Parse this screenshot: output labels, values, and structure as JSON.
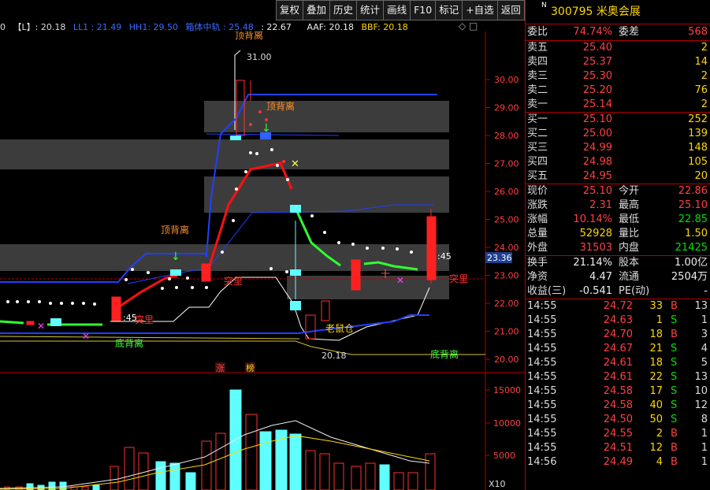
{
  "toolbar": [
    "复权",
    "叠加",
    "历史",
    "统计",
    "画线",
    "F10",
    "标记",
    "+自选",
    "返回"
  ],
  "indicator_bar": {
    "prefix": "0",
    "l_label": "【L】: 20.18",
    "ll1": "LL1 : 21.49",
    "hh1": "HH1: 29.50",
    "mid": "箱体中轨 : 25.48",
    "mid_val": ": 22.67",
    "aaf": "AAF: 20.18",
    "bbf": "BBF: 20.18"
  },
  "chart": {
    "price_axis": [
      "30.00",
      "29.00",
      "28.00",
      "27.00",
      "26.00",
      "25.00",
      "24.00",
      "23.00",
      "22.00",
      "21.00",
      "20.00"
    ],
    "current_price_tag": "23.36",
    "volume_axis": [
      "15000",
      "10000",
      "5000"
    ],
    "volume_unit": "X10",
    "annotations": {
      "high_value": "31.00",
      "low_value": "20.18",
      "top_divergence_1": "顶背离",
      "top_divergence_2": "顶背离",
      "top_divergence_cut": "顶背离",
      "bottom_divergence_1": "底背离",
      "bottom_divergence_2": "底背离",
      "breakout_1": "突里",
      "breakout_2": "突里",
      "breakout_3": "突里",
      "old_mouse": "老鼠仓",
      "time_45_a": ":45",
      "time_45_b": ":45",
      "tag_zhang": "涨",
      "tag_bang": "榜",
      "doji_marker": "十"
    }
  },
  "stock": {
    "code": "300795",
    "name": "米奥会展",
    "n_mark": "N"
  },
  "weibi": {
    "label1": "委比",
    "value": "74.74%",
    "label2": "委差",
    "diff": "568"
  },
  "asks": [
    {
      "label": "卖五",
      "price": "25.40",
      "vol": "2"
    },
    {
      "label": "卖四",
      "price": "25.37",
      "vol": "14"
    },
    {
      "label": "卖三",
      "price": "25.30",
      "vol": "2"
    },
    {
      "label": "卖二",
      "price": "25.20",
      "vol": "76"
    },
    {
      "label": "卖一",
      "price": "25.14",
      "vol": "2"
    }
  ],
  "bids": [
    {
      "label": "买一",
      "price": "25.10",
      "vol": "252"
    },
    {
      "label": "买二",
      "price": "25.00",
      "vol": "139"
    },
    {
      "label": "买三",
      "price": "24.99",
      "vol": "148"
    },
    {
      "label": "买四",
      "price": "24.98",
      "vol": "105"
    },
    {
      "label": "买五",
      "price": "24.95",
      "vol": "20"
    }
  ],
  "quote1": [
    {
      "l1": "现价",
      "v1": "25.10",
      "l2": "今开",
      "v2": "22.86"
    },
    {
      "l1": "涨跌",
      "v1": "2.31",
      "l2": "最高",
      "v2": "25.10"
    },
    {
      "l1": "涨幅",
      "v1": "10.14%",
      "l2": "最低",
      "v2": "22.85"
    },
    {
      "l1": "总量",
      "v1": "52928",
      "l2": "量比",
      "v2": "1.50"
    },
    {
      "l1": "外盘",
      "v1": "31503",
      "l2": "内盘",
      "v2": "21425"
    }
  ],
  "quote2": [
    {
      "l1": "换手",
      "v1": "21.14%",
      "l2": "股本",
      "v2": "1.00亿"
    },
    {
      "l1": "净资",
      "v1": "4.47",
      "l2": "流通",
      "v2": "2504万"
    },
    {
      "l1": "收益(三)",
      "v1": "-0.541",
      "l2": "PE(动)",
      "v2": "-"
    }
  ],
  "ticks": [
    {
      "t": "14:55",
      "p": "24.72",
      "v": "33",
      "s": "B",
      "n": "13"
    },
    {
      "t": "14:55",
      "p": "24.63",
      "v": "1",
      "s": "S",
      "n": "1"
    },
    {
      "t": "14:55",
      "p": "24.70",
      "v": "18",
      "s": "B",
      "n": "3"
    },
    {
      "t": "14:55",
      "p": "24.67",
      "v": "21",
      "s": "S",
      "n": "4"
    },
    {
      "t": "14:55",
      "p": "24.61",
      "v": "18",
      "s": "S",
      "n": "5"
    },
    {
      "t": "14:55",
      "p": "24.61",
      "v": "22",
      "s": "S",
      "n": "13"
    },
    {
      "t": "14:55",
      "p": "24.58",
      "v": "17",
      "s": "S",
      "n": "10"
    },
    {
      "t": "14:55",
      "p": "24.58",
      "v": "40",
      "s": "S",
      "n": "12"
    },
    {
      "t": "14:55",
      "p": "24.50",
      "v": "50",
      "s": "S",
      "n": "8"
    },
    {
      "t": "14:55",
      "p": "24.55",
      "v": "2",
      "s": "B",
      "n": "1"
    },
    {
      "t": "14:55",
      "p": "24.51",
      "v": "12",
      "s": "B",
      "n": "1"
    },
    {
      "t": "14:56",
      "p": "24.49",
      "v": "4",
      "s": "B",
      "n": "1"
    }
  ],
  "colors": {
    "up": "#ff3030",
    "down": "#50ffff",
    "panel_border": "#b30000",
    "price_text": "#ff4040"
  }
}
